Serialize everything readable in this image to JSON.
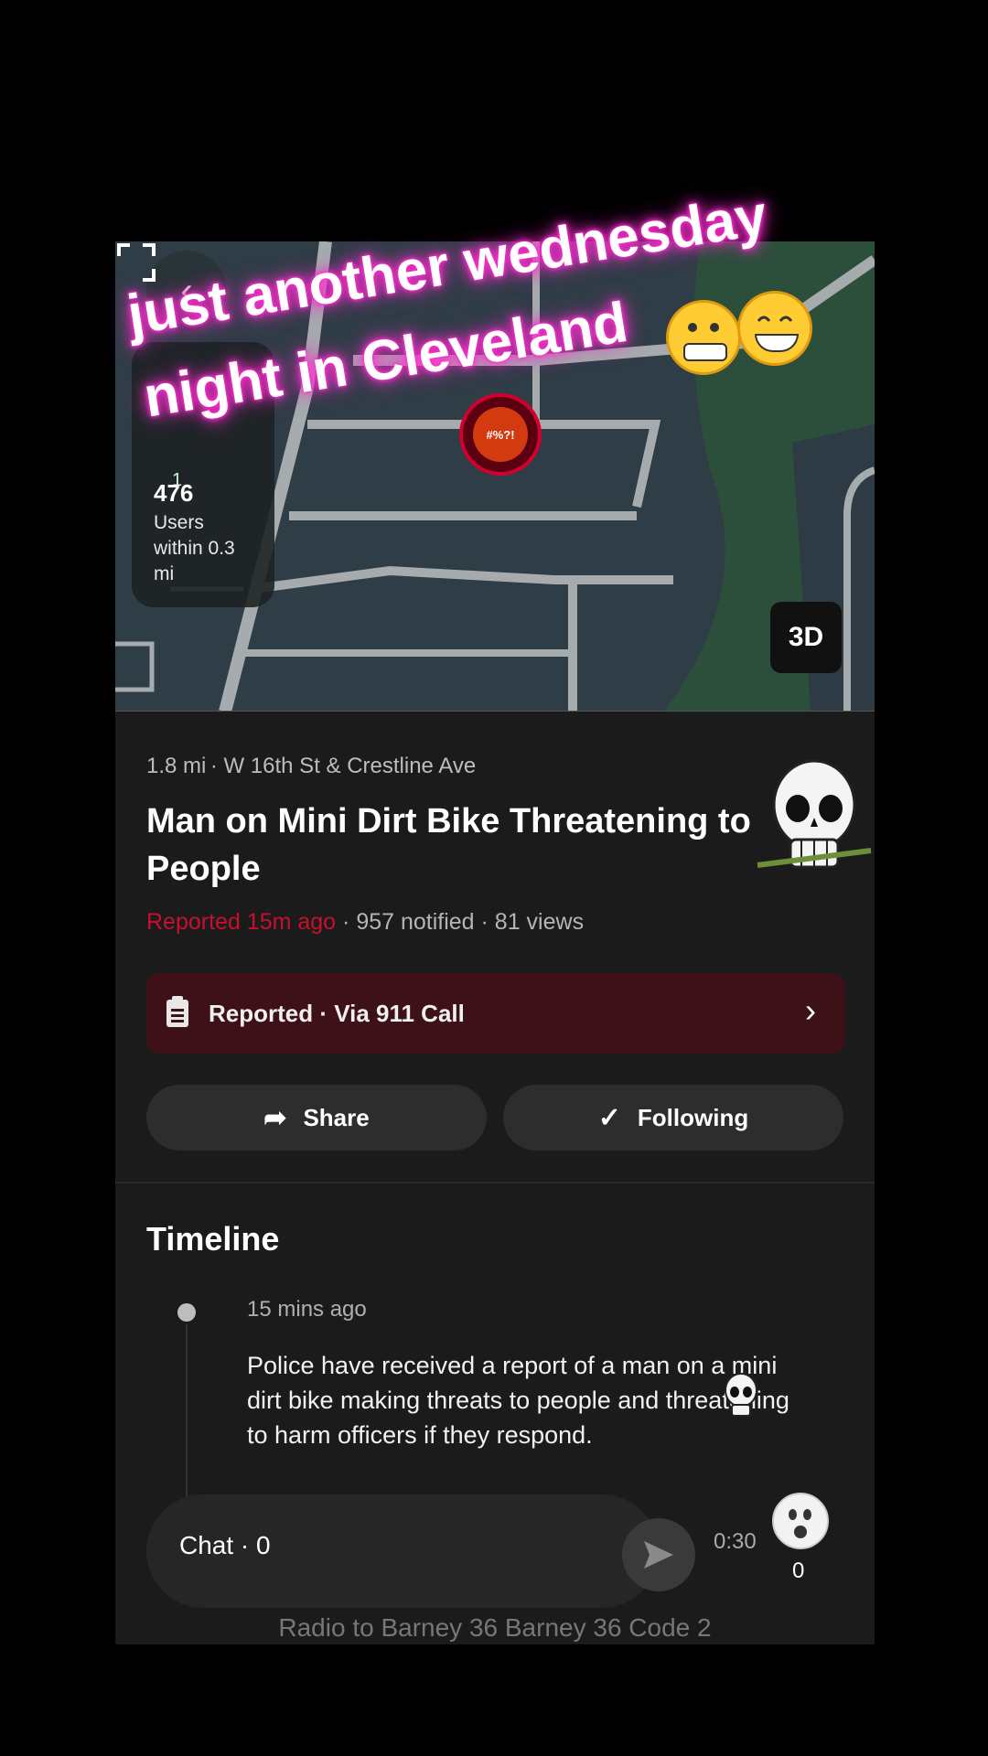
{
  "map": {
    "users_count": "476",
    "users_label": "Users within 0.3 mi",
    "small_badge": "1",
    "btn_3d": "3D",
    "back_icon": "chevron-left-icon",
    "expand_icon": "expand-icon",
    "pin_text": "#%?!"
  },
  "caption": {
    "line1": "just another wednesday",
    "line2": "night in Cleveland"
  },
  "incident": {
    "distance": "1.8 mi",
    "location": "W 16th St & Crestline Ave",
    "title": "Man on Mini Dirt Bike Threatening to People",
    "reported_time": "Reported 15m ago",
    "stats_rest": "· 957 notified · 81 views",
    "reported_bar": "Reported · Via 911 Call"
  },
  "actions": {
    "share_label": "Share",
    "following_label": "Following"
  },
  "timeline": {
    "title": "Timeline",
    "entries": [
      {
        "time": "15 mins ago",
        "text": "Police have received a report of a man on a mini dirt bike making threats to people and threatening to harm officers if they respond."
      }
    ]
  },
  "chat": {
    "label": "Chat · 0",
    "timer": "0:30",
    "reaction_count": "0"
  },
  "radio": {
    "text": "Radio to Barney 36 Barney 36 Code 2"
  },
  "colors": {
    "accent_red": "#c8102e",
    "reported_bar_bg": "#3e1018",
    "caption_glow": "#ff2fd0"
  }
}
